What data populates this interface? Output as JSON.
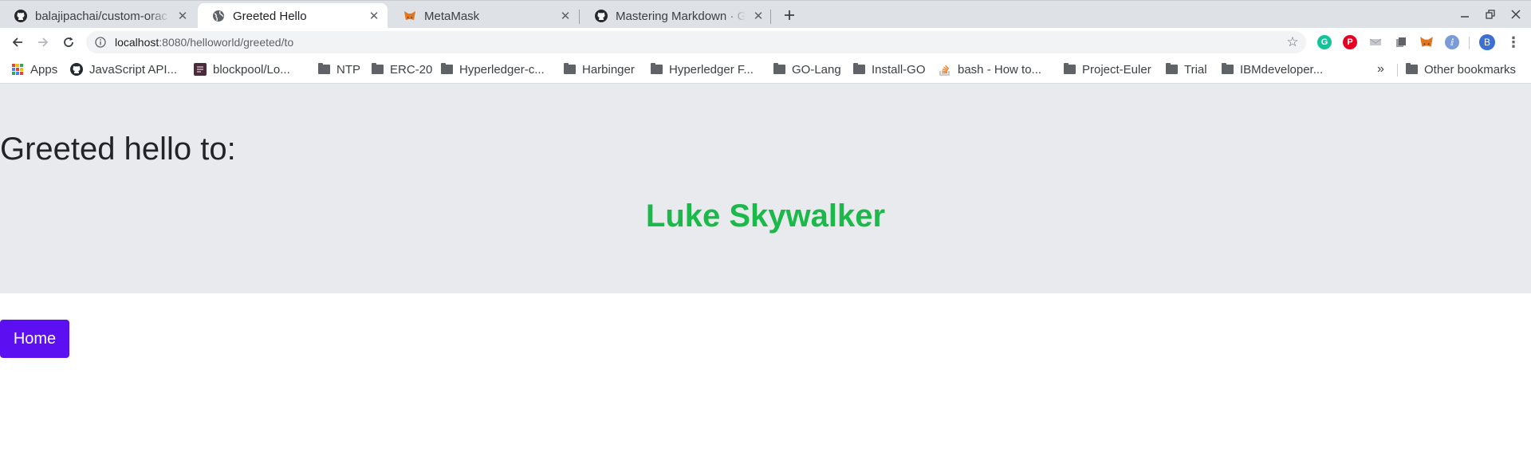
{
  "browser": {
    "tabs": [
      {
        "title": "balajipachai/custom-orac",
        "icon": "github-icon",
        "active": false
      },
      {
        "title": "Greeted Hello",
        "icon": "globe-icon",
        "active": true
      },
      {
        "title": "MetaMask",
        "icon": "metamask-fox-icon",
        "active": false
      },
      {
        "title": "Mastering Markdown · Git",
        "icon": "github-icon",
        "active": false
      }
    ],
    "url": {
      "host": "localhost",
      "path": ":8080/helloworld/greeted/to"
    },
    "avatar_letter": "B",
    "extensions": [
      "grammarly-icon",
      "pinterest-icon",
      "extension-icon",
      "extension-icon",
      "metamask-fox-icon",
      "extension-icon"
    ],
    "bookmarks": [
      {
        "label": "Apps",
        "icon": "apps-grid-icon"
      },
      {
        "label": "JavaScript API...",
        "icon": "github-icon"
      },
      {
        "label": "blockpool/Lo...",
        "icon": "blockpool-icon"
      },
      {
        "label": "NTP",
        "icon": "folder-icon"
      },
      {
        "label": "ERC-20",
        "icon": "folder-icon"
      },
      {
        "label": "Hyperledger-c...",
        "icon": "folder-icon"
      },
      {
        "label": "Harbinger",
        "icon": "folder-icon"
      },
      {
        "label": "Hyperledger F...",
        "icon": "folder-icon"
      },
      {
        "label": "GO-Lang",
        "icon": "folder-icon"
      },
      {
        "label": "Install-GO",
        "icon": "folder-icon"
      },
      {
        "label": "bash - How to...",
        "icon": "stackoverflow-icon"
      },
      {
        "label": "Project-Euler",
        "icon": "folder-icon"
      },
      {
        "label": "Trial",
        "icon": "folder-icon"
      },
      {
        "label": "IBMdeveloper...",
        "icon": "folder-icon"
      }
    ],
    "more_bookmarks": "»",
    "other_bookmarks": "Other bookmarks"
  },
  "page": {
    "heading": "Greeted hello to:",
    "name": "Luke Skywalker",
    "home_button": "Home"
  },
  "colors": {
    "name": "#1bb84a",
    "home_button": "#5c0ff0",
    "jumbotron": "#e9eaee"
  }
}
